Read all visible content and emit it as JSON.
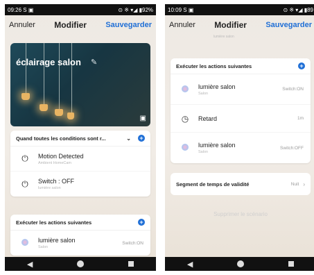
{
  "left": {
    "status": {
      "time": "09:26",
      "left_icons": "S ▣",
      "right": "⊙ ※ ▾◢ ▮92%"
    },
    "topbar": {
      "cancel": "Annuler",
      "title": "Modifier",
      "save": "Sauvegarder"
    },
    "hero": {
      "title": "éclairage salon"
    },
    "conditions": {
      "header": "Quand toutes les conditions sont r...",
      "items": [
        {
          "title": "Motion Detected",
          "subtitle": "Ambient HomeCam"
        },
        {
          "title": "Switch : OFF",
          "subtitle": "lumière salon"
        }
      ]
    },
    "actions": {
      "header": "Exécuter les actions suivantes",
      "items": [
        {
          "title": "lumière salon",
          "subtitle": "Salon",
          "status": "Switch:ON"
        }
      ]
    }
  },
  "right": {
    "status": {
      "time": "10:09",
      "left_icons": "S ▣",
      "right": "⊙ ※ ▾◢ ▮89"
    },
    "topbar": {
      "cancel": "Annuler",
      "title": "Modifier",
      "save": "Sauvegarder"
    },
    "truncated_text": "lumière salon",
    "actions": {
      "header": "Exécuter les actions suivantes",
      "items": [
        {
          "title": "lumière salon",
          "subtitle": "Salon",
          "status": "Switch:ON",
          "icon": "bulb-icon"
        },
        {
          "title": "Retard",
          "subtitle": "",
          "status": "1m",
          "icon": "timer-icon"
        },
        {
          "title": "lumière salon",
          "subtitle": "Salon",
          "status": "Switch:OFF",
          "icon": "bulb-icon"
        }
      ]
    },
    "segment": {
      "label": "Segment de temps de validité",
      "value": "Nuit"
    },
    "delete_label": "Supprimer le scénario"
  },
  "colors": {
    "accent": "#1f6fd6",
    "background": "#eee9e3"
  }
}
